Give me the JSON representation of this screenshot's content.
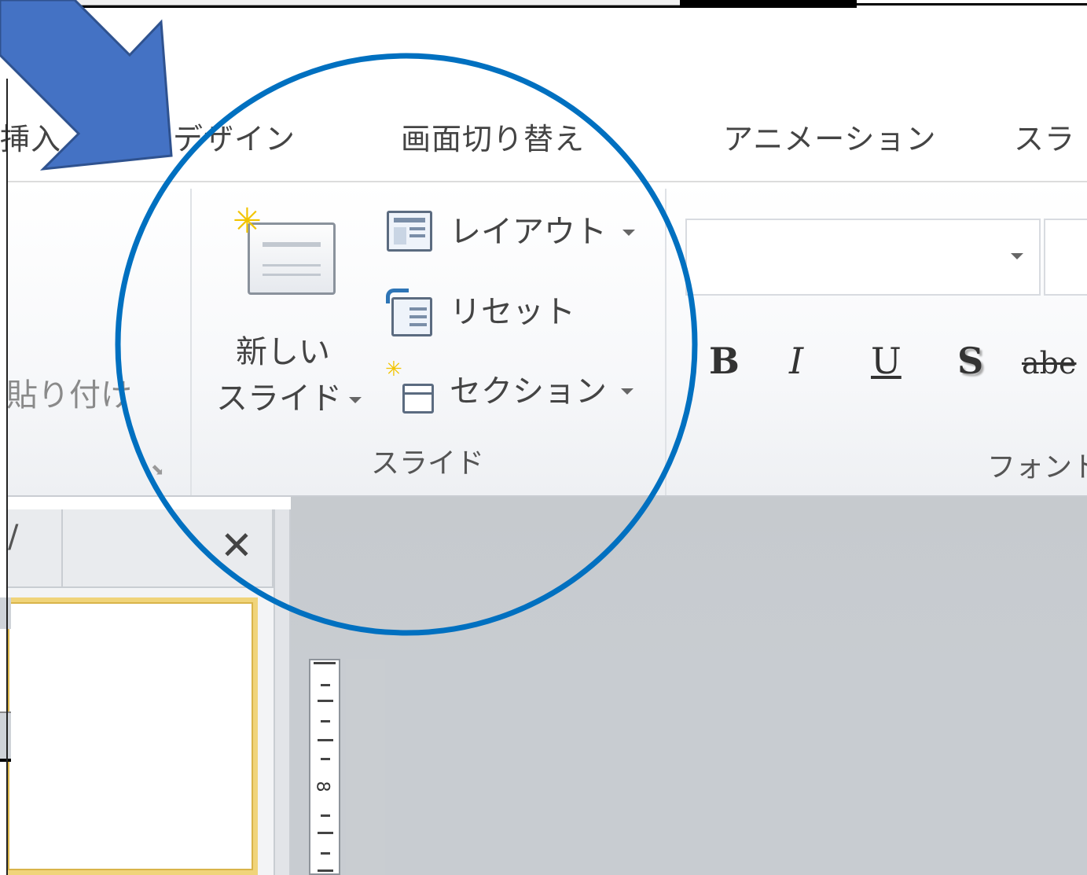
{
  "tabs": {
    "insert": "挿入",
    "design": "デザイン",
    "transitions": "画面切り替え",
    "animations": "アニメーション",
    "slideshow": "スラ"
  },
  "clipboard": {
    "paste_label": "貼り付け"
  },
  "slides_group": {
    "new_slide_line1": "新しい",
    "new_slide_line2": "スライド",
    "layout": "レイアウト",
    "reset": "リセット",
    "section": "セクション",
    "group_label": "スライド"
  },
  "font_group": {
    "bold": "B",
    "italic": "I",
    "underline": "U",
    "shadow": "S",
    "strikethrough": "abe",
    "group_label": "フォント"
  },
  "ruler": {
    "number": "8"
  },
  "colors": {
    "arrow": "#4472c4",
    "highlight_circle": "#0070c0"
  }
}
